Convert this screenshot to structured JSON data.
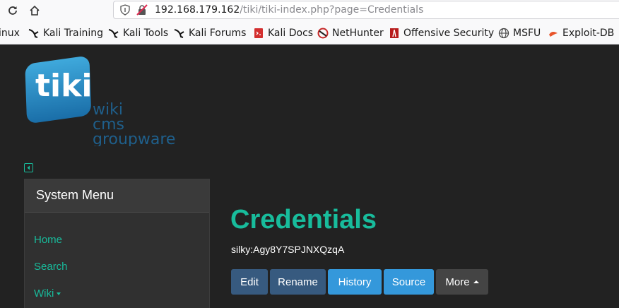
{
  "browser": {
    "url_host": "192.168.179.162",
    "url_path": "/tiki/tiki-index.php?page=Credentials",
    "bookmarks": [
      {
        "label": "inux",
        "icon": "kali-dragon-icon"
      },
      {
        "label": "Kali Training",
        "icon": "kali-dragon-icon"
      },
      {
        "label": "Kali Tools",
        "icon": "kali-dragon-icon"
      },
      {
        "label": "Kali Forums",
        "icon": "kali-dragon-icon"
      },
      {
        "label": "Kali Docs",
        "icon": "kali-docs-icon"
      },
      {
        "label": "NetHunter",
        "icon": "nethunter-icon"
      },
      {
        "label": "Offensive Security",
        "icon": "offsec-icon"
      },
      {
        "label": "MSFU",
        "icon": "globe-icon"
      },
      {
        "label": "Exploit-DB",
        "icon": "exploitdb-icon"
      }
    ]
  },
  "logo": {
    "brand": "tiki",
    "tagline": [
      "wiki",
      "cms",
      "groupware"
    ]
  },
  "sidebar": {
    "title": "System Menu",
    "items": [
      {
        "label": "Home"
      },
      {
        "label": "Search"
      },
      {
        "label": "Wiki"
      }
    ]
  },
  "page": {
    "title": "Credentials",
    "content": "silky:Agy8Y7SPJNXQzqA"
  },
  "actions": [
    {
      "label": "Edit"
    },
    {
      "label": "Rename"
    },
    {
      "label": "History"
    },
    {
      "label": "Source"
    },
    {
      "label": "More"
    }
  ],
  "colors": {
    "accent": "#18bc9c",
    "background": "#222222",
    "button_primary": "#375a7f",
    "button_info": "#3498db",
    "button_secondary": "#444444"
  }
}
